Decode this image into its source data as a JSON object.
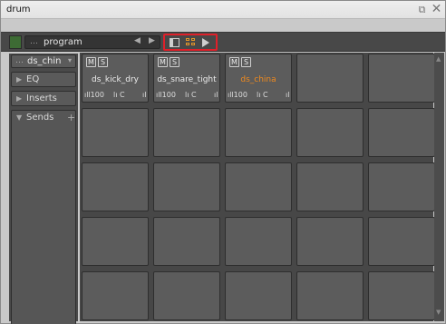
{
  "window": {
    "title": "drum",
    "restore_icon": "restore-window-icon",
    "close_icon": "close-icon"
  },
  "toolbar": {
    "program_dots": "…",
    "program_label": "program",
    "prev_glyph": "◀",
    "next_glyph": "▶",
    "view_icons": [
      "panel-view-icon",
      "grid-view-icon",
      "play-icon"
    ]
  },
  "sidebar": {
    "instrument": "ds_china",
    "instrument_dots": "…",
    "instrument_chevron": "▾",
    "sections": [
      {
        "label": "EQ",
        "arrow": "▶"
      },
      {
        "label": "Inserts",
        "arrow": "▶"
      },
      {
        "label": "Sends",
        "arrow": "▼",
        "plus": "+"
      }
    ]
  },
  "pads": [
    {
      "name": "ds_kick_dry",
      "m": "M",
      "s": "S",
      "volume": "ıll100",
      "pan": "lı C",
      "out": "ıl",
      "active": false
    },
    {
      "name": "ds_snare_tight",
      "m": "M",
      "s": "S",
      "volume": "ıll100",
      "pan": "lı C",
      "out": "ıl",
      "active": false
    },
    {
      "name": "ds_china",
      "m": "M",
      "s": "S",
      "volume": "ıll100",
      "pan": "lı C",
      "out": "ıl",
      "active": true
    }
  ],
  "grid": {
    "columns": 5,
    "rows": 5
  },
  "colors": {
    "accent_orange": "#f08a1e",
    "highlight_red": "#e0202a",
    "led_green": "#3d6b34"
  }
}
